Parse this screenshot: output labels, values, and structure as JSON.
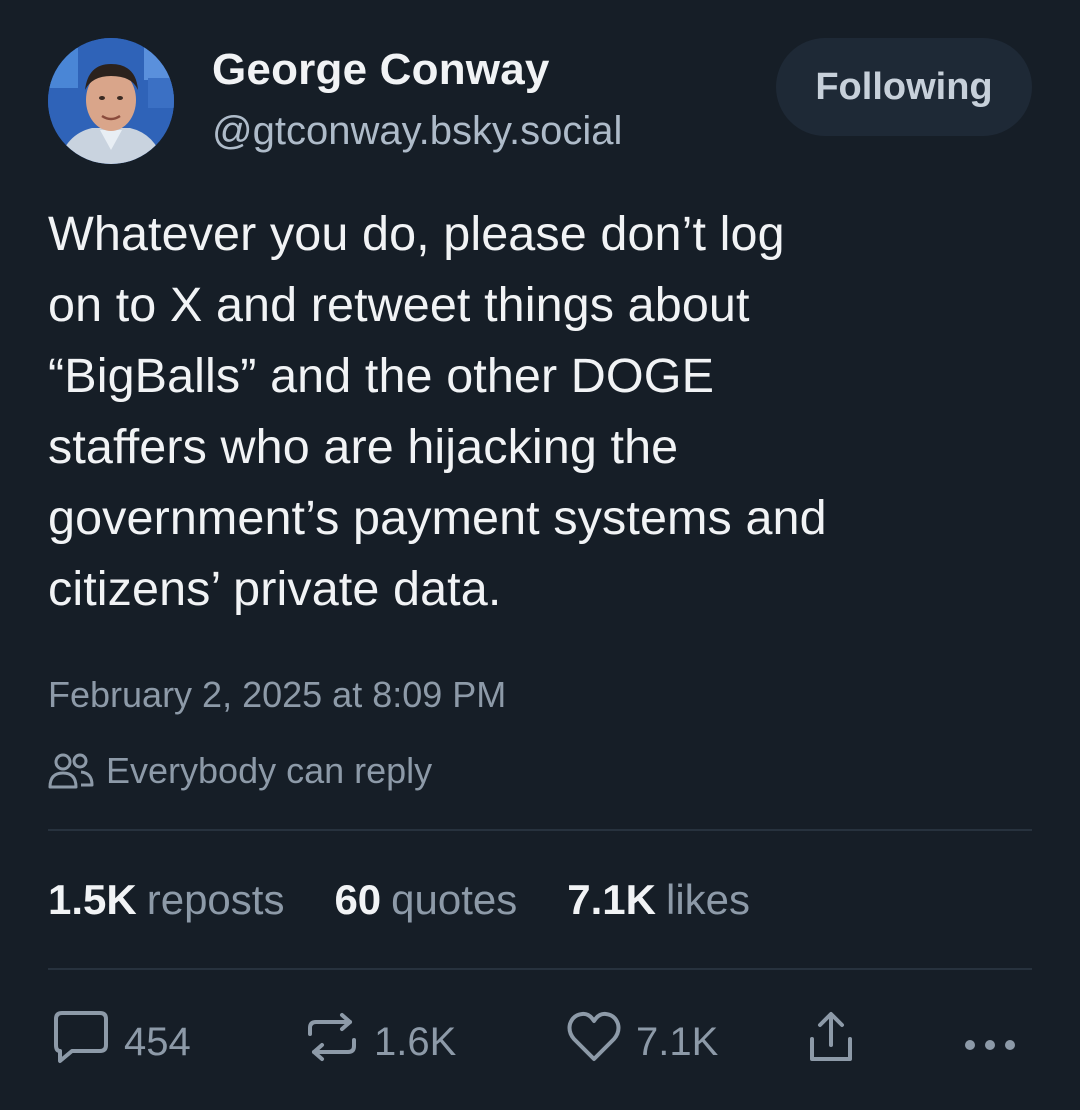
{
  "author": {
    "display_name": "George Conway",
    "handle": "@gtconway.bsky.social"
  },
  "follow_button": {
    "label": "Following"
  },
  "post": {
    "text": "Whatever you do, please don’t log\non to X and retweet things about\n“BigBalls” and the other DOGE\nstaffers who are hijacking the\ngovernment’s payment systems and\ncitizens’ private data.",
    "timestamp": "February 2, 2025 at 8:09 PM",
    "reply_setting": "Everybody can reply"
  },
  "stats": {
    "reposts": {
      "count": "1.5K",
      "label": "reposts"
    },
    "quotes": {
      "count": "60",
      "label": "quotes"
    },
    "likes": {
      "count": "7.1K",
      "label": "likes"
    }
  },
  "actions": {
    "reply": {
      "count": "454",
      "icon": "speech-bubble-icon"
    },
    "repost": {
      "count": "1.6K",
      "icon": "repost-arrows-icon"
    },
    "like": {
      "count": "7.1K",
      "icon": "heart-icon"
    },
    "share": {
      "icon": "share-icon"
    },
    "more": {
      "icon": "ellipsis-icon"
    }
  },
  "colors": {
    "background": "#161e27",
    "primary_text": "#f1f3f5",
    "secondary_text": "#8d9aa8",
    "button_bg": "#1e2936"
  }
}
